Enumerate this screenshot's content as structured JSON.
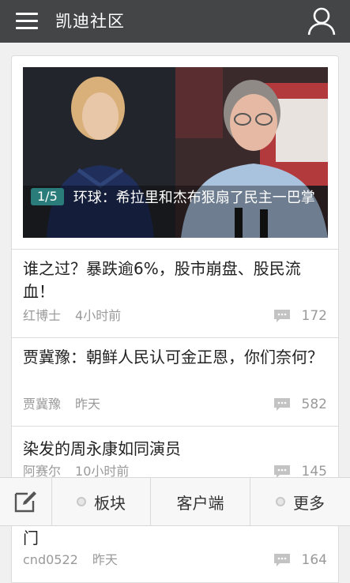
{
  "header": {
    "title": "凯迪社区",
    "menu_icon": "hamburger-menu-icon",
    "user_icon": "user-profile-icon"
  },
  "hero": {
    "counter": "1/5",
    "caption": "环球：希拉里和杰布狠扇了民主一巴掌"
  },
  "posts": [
    {
      "title": "谁之过？暴跌逾6%，股市崩盘、股民流血！",
      "author": "红博士",
      "time": "4小时前",
      "replies": "172"
    },
    {
      "title": "贾冀豫：朝鲜人民认可金正恩，你们奈何？",
      "author": "贾冀豫",
      "time": "昨天",
      "replies": "582"
    },
    {
      "title": "染发的周永康如同演员",
      "author": "阿赛尔",
      "time": "10小时前",
      "replies": "145"
    },
    {
      "title": "门",
      "author": "cnd0522",
      "time": "昨天",
      "replies": "164"
    }
  ],
  "bottom_nav": {
    "compose_icon": "compose-icon",
    "board": "板块",
    "client": "客户端",
    "more": "更多"
  },
  "colors": {
    "header_bg": "#444546",
    "counter_bg": "#2a7c7a",
    "meta_text": "#9a9a9a"
  }
}
